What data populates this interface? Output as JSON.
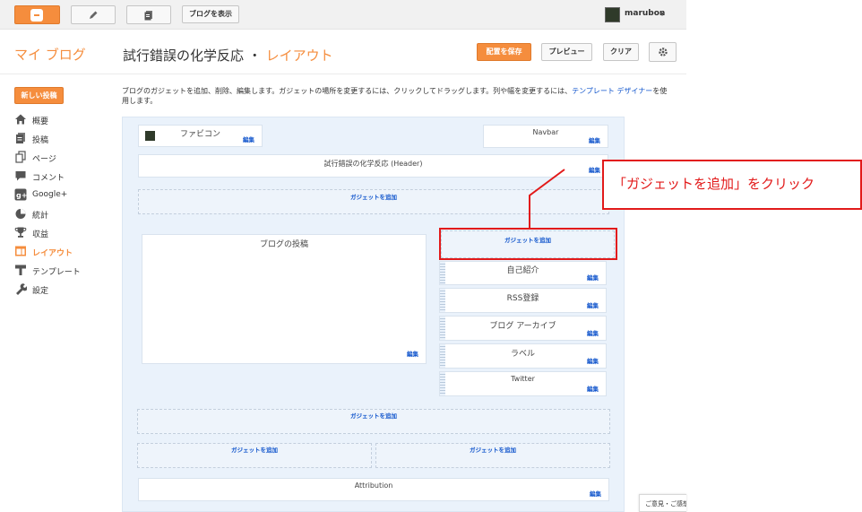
{
  "topbar": {
    "view_blog_label": "ブログを表示",
    "username": "marubon"
  },
  "header": {
    "my_blog": "マイ ブログ",
    "blog_name": "試行錯誤の化学反応",
    "separator": "・",
    "section": "レイアウト",
    "save_label": "配置を保存",
    "preview_label": "プレビュー",
    "clear_label": "クリア"
  },
  "sidebar": {
    "new_post_label": "新しい投稿",
    "items": [
      {
        "label": "概要",
        "icon": "home-icon"
      },
      {
        "label": "投稿",
        "icon": "posts-icon"
      },
      {
        "label": "ページ",
        "icon": "pages-icon"
      },
      {
        "label": "コメント",
        "icon": "comment-icon"
      },
      {
        "label": "Google+",
        "icon": "google-plus-icon"
      },
      {
        "label": "統計",
        "icon": "stats-pie-icon"
      },
      {
        "label": "収益",
        "icon": "trophy-icon"
      },
      {
        "label": "レイアウト",
        "icon": "layout-icon",
        "active": true
      },
      {
        "label": "テンプレート",
        "icon": "template-icon"
      },
      {
        "label": "設定",
        "icon": "wrench-icon"
      }
    ]
  },
  "description": {
    "text_before": "ブログのガジェットを追加、削除、編集します。ガジェットの場所を変更するには、クリックしてドラッグします。列や幅を変更するには、",
    "link": "テンプレート デザイナー",
    "text_after": "を使用します。"
  },
  "layout": {
    "edit_label": "編集",
    "add_gadget_label": "ガジェットを追加",
    "favicon_title": "ファビコン",
    "navbar_title": "Navbar",
    "header_title": "試行錯誤の化学反応 (Header)",
    "blog_posts_title": "ブログの投稿",
    "sidebar_gadgets": [
      "自己紹介",
      "RSS登録",
      "ブログ アーカイブ",
      "ラベル",
      "Twitter"
    ],
    "attribution_title": "Attribution"
  },
  "annotation": {
    "callout_text": "「ガジェットを追加」をクリック",
    "color": "#e21a1a"
  },
  "feedback_label": "ご意見・ご感想",
  "colors": {
    "accent": "#f58d3d",
    "link": "#1155cc"
  }
}
